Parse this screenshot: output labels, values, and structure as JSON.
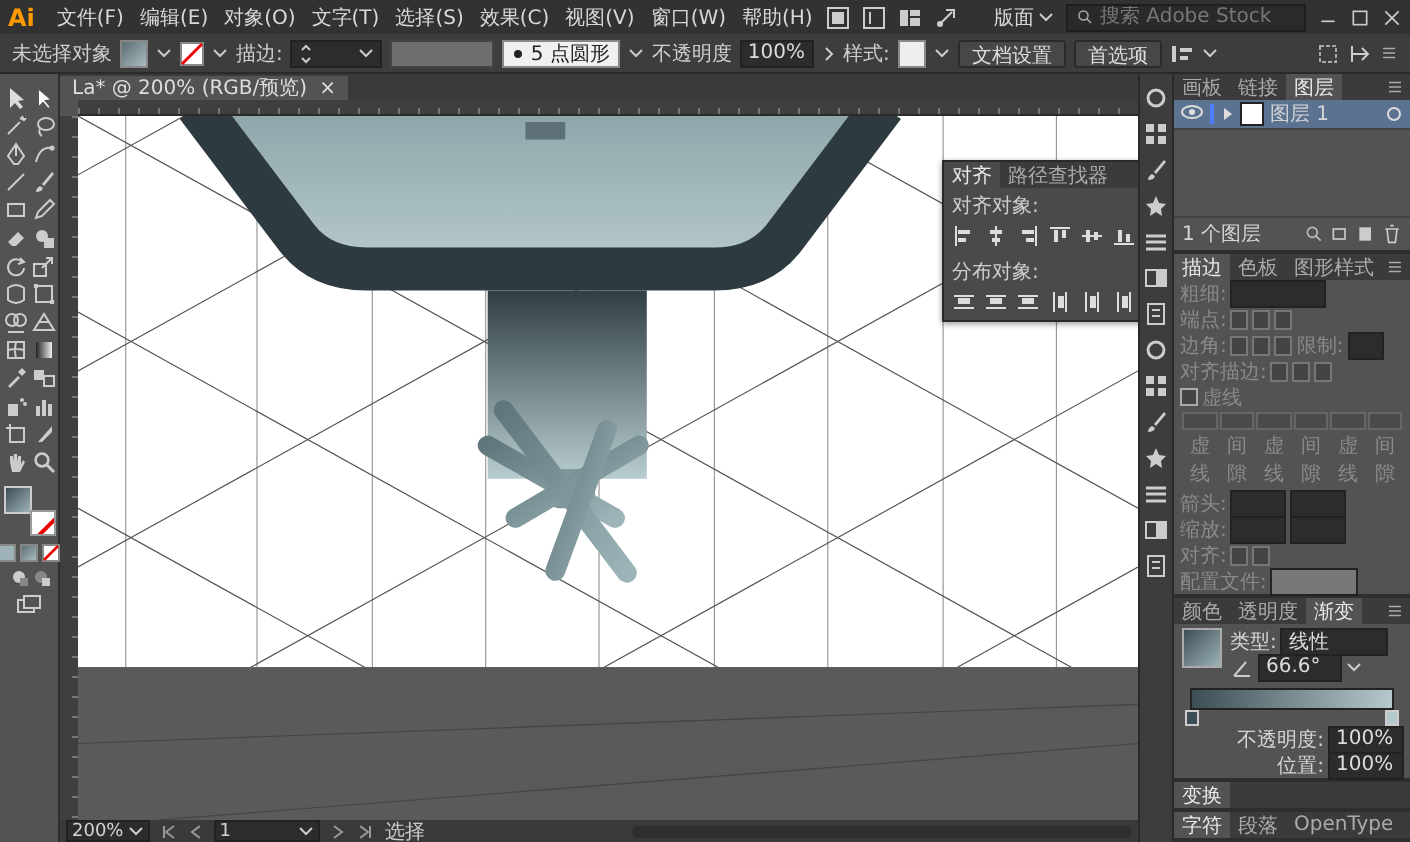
{
  "app": {
    "logo": "Ai"
  },
  "menu": [
    "文件(F)",
    "编辑(E)",
    "对象(O)",
    "文字(T)",
    "选择(S)",
    "效果(C)",
    "视图(V)",
    "窗口(W)",
    "帮助(H)"
  ],
  "workspace": {
    "label": "版面"
  },
  "search": {
    "placeholder": "搜索 Adobe Stock"
  },
  "control_bar": {
    "selection": "未选择对象",
    "stroke_label": "描边:",
    "brush": "5 点圆形",
    "opacity_label": "不透明度",
    "opacity": "100%",
    "style_label": "样式:",
    "buttons": [
      "文档设置",
      "首选项"
    ]
  },
  "document_tab": {
    "title": "La* @ 200% (RGB/预览)",
    "close": "×"
  },
  "align_panel": {
    "tabs": [
      {
        "label": "对齐",
        "selected": true
      },
      {
        "label": "路径查找器",
        "selected": false
      }
    ],
    "sections": [
      "对齐对象:",
      "分布对象:"
    ]
  },
  "layers_panel": {
    "tabs": [
      {
        "label": "画板",
        "selected": false
      },
      {
        "label": "链接",
        "selected": false
      },
      {
        "label": "图层",
        "selected": true
      }
    ],
    "layers": [
      {
        "name": "图层 1",
        "visible": true,
        "selected": true
      }
    ],
    "footer": "1 个图层"
  },
  "stroke_panel": {
    "tabs": [
      {
        "label": "描边",
        "selected": true
      },
      {
        "label": "色板",
        "selected": false
      },
      {
        "label": "图形样式",
        "selected": false
      }
    ],
    "disabled": true,
    "weight_label": "粗细:",
    "cap_label": "端点:",
    "corner_label": "边角:",
    "limit_label": "限制:",
    "align_label": "对齐描边:",
    "dashed": {
      "label": "虚线",
      "checked": false
    },
    "dash_labels": [
      "虚线",
      "间隙",
      "虚线",
      "间隙",
      "虚线",
      "间隙"
    ],
    "arrow_label": "箭头:",
    "scale_label": "缩放:",
    "arrow_align_label": "对齐:",
    "profile_label": "配置文件:"
  },
  "gradient_panel": {
    "tabs": [
      {
        "label": "颜色",
        "selected": false
      },
      {
        "label": "透明度",
        "selected": false
      },
      {
        "label": "渐变",
        "selected": true
      }
    ],
    "type_label": "类型:",
    "type": "线性",
    "stops": [
      {
        "color": "#3c4e54",
        "level": 0
      },
      {
        "color": "#b5c9cc",
        "level": 1
      }
    ],
    "angle": "66.6°",
    "opacity_label": "不透明度:",
    "opacity": "100%",
    "location_label": "位置:",
    "location": "100%"
  },
  "collapsed_panels": [
    {
      "tabs": [
        {
          "label": "变换",
          "selected": true
        }
      ]
    },
    {
      "tabs": [
        {
          "label": "字符",
          "selected": true
        },
        {
          "label": "段落",
          "selected": false
        },
        {
          "label": "OpenType",
          "selected": false
        }
      ]
    }
  ],
  "status_bar": {
    "zoom": "200%",
    "artboard": "1",
    "tool": "选择"
  }
}
